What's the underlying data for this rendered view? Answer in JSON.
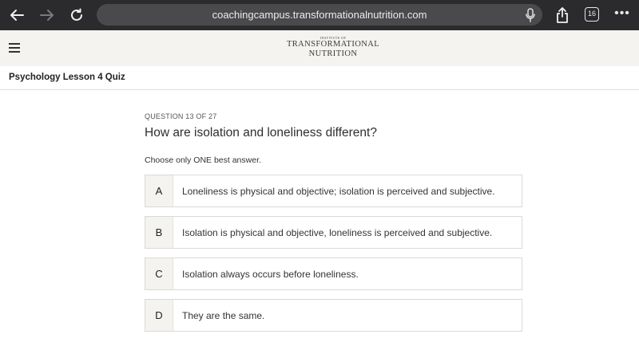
{
  "browser": {
    "url": "coachingcampus.transformationalnutrition.com",
    "tab_count": "16",
    "more_label": "•••",
    "icons": [
      "back-arrow-icon",
      "forward-arrow-icon",
      "reload-icon",
      "microphone-icon",
      "share-icon",
      "tabs-icon",
      "more-icon"
    ]
  },
  "header": {
    "logo_small": "INSTITUTE OF",
    "logo_line1": "TRANSFORMATIONAL",
    "logo_line2": "NUTRITION"
  },
  "course": {
    "title": "Psychology Lesson 4 Quiz"
  },
  "quiz": {
    "counter": "QUESTION 13 OF 27",
    "question": "How are isolation and loneliness different?",
    "instruction": "Choose only ONE best answer.",
    "answers": [
      {
        "letter": "A",
        "text": "Loneliness is physical and objective; isolation is perceived and subjective."
      },
      {
        "letter": "B",
        "text": "Isolation is physical and objective, loneliness is perceived and subjective."
      },
      {
        "letter": "C",
        "text": "Isolation always occurs before loneliness."
      },
      {
        "letter": "D",
        "text": "They are the same."
      }
    ]
  },
  "colors": {
    "browser_bar": "#2b2b2d",
    "url_field": "#4a4a4d",
    "header_bg": "#f5f3ef",
    "letter_bg": "#f5f3ef"
  }
}
